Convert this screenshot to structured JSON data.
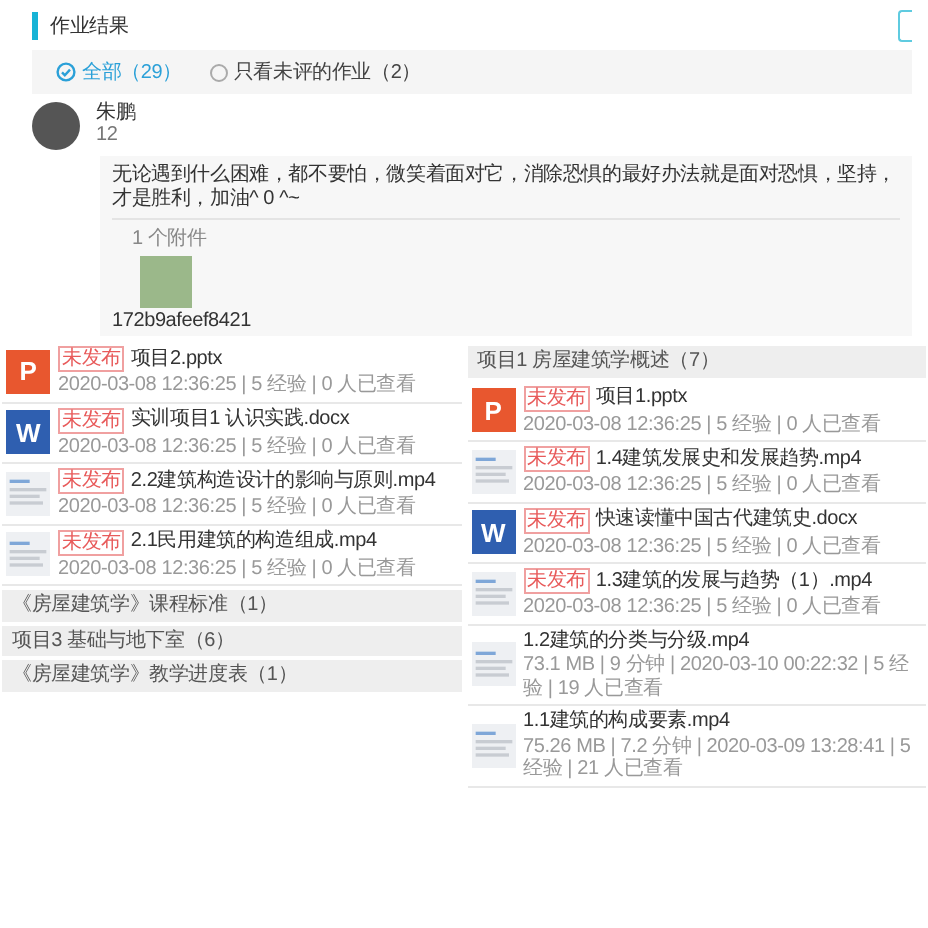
{
  "homework": {
    "title": "作业结果",
    "filters": [
      {
        "label": "全部（29）",
        "selected": true
      },
      {
        "label": "只看未评的作业（2）",
        "selected": false
      }
    ],
    "student": {
      "name": "朱鹏",
      "score": "12"
    },
    "comment": "无论遇到什么困难，都不要怕，微笑着面对它，消除恐惧的最好办法就是面对恐惧，坚持，才是胜利，加油^ 0 ^~",
    "attachments_label": "1 个附件",
    "attachment": {
      "filename": "172b9afeef8421"
    }
  },
  "left_list": [
    {
      "kind": "ppt",
      "icon_letter": "P",
      "badge": "未发布",
      "name": "项目2.pptx",
      "meta": "2020-03-08 12:36:25 | 5 经验 | 0 人已查看"
    },
    {
      "kind": "doc",
      "icon_letter": "W",
      "badge": "未发布",
      "name": "实训项目1 认识实践.docx",
      "meta": "2020-03-08 12:36:25 | 5 经验 | 0 人已查看"
    },
    {
      "kind": "video",
      "badge": "未发布",
      "name": "2.2建筑构造设计的影响与原则.mp4",
      "meta": "2020-03-08 12:36:25 | 5 经验 | 0 人已查看"
    },
    {
      "kind": "video",
      "badge": "未发布",
      "name": "2.1民用建筑的构造组成.mp4",
      "meta": "2020-03-08 12:36:25 | 5 经验 | 0 人已查看"
    },
    {
      "kind": "section",
      "name": "《房屋建筑学》课程标准（1）"
    },
    {
      "kind": "section",
      "name": "项目3 基础与地下室（6）"
    },
    {
      "kind": "section",
      "name": "《房屋建筑学》教学进度表（1）"
    }
  ],
  "right_list": [
    {
      "kind": "section",
      "name": "项目1 房屋建筑学概述（7）"
    },
    {
      "kind": "ppt",
      "icon_letter": "P",
      "badge": "未发布",
      "name": "项目1.pptx",
      "meta": "2020-03-08 12:36:25 | 5 经验 | 0 人已查看"
    },
    {
      "kind": "video",
      "badge": "未发布",
      "name": "1.4建筑发展史和发展趋势.mp4",
      "meta": "2020-03-08 12:36:25 | 5 经验 | 0 人已查看"
    },
    {
      "kind": "doc",
      "icon_letter": "W",
      "badge": "未发布",
      "name": "快速读懂中国古代建筑史.docx",
      "meta": "2020-03-08 12:36:25 | 5 经验 | 0 人已查看"
    },
    {
      "kind": "video",
      "badge": "未发布",
      "name": "1.3建筑的发展与趋势（1）.mp4",
      "meta": "2020-03-08 12:36:25 | 5 经验 | 0 人已查看"
    },
    {
      "kind": "video",
      "name": "1.2建筑的分类与分级.mp4",
      "meta": "73.1 MB | 9 分钟 | 2020-03-10 00:22:32 | 5 经验 | 19 人已查看"
    },
    {
      "kind": "video",
      "name": "1.1建筑的构成要素.mp4",
      "meta": "75.26 MB | 7.2 分钟 | 2020-03-09 13:28:41 | 5 经验 | 21 人已查看"
    }
  ]
}
